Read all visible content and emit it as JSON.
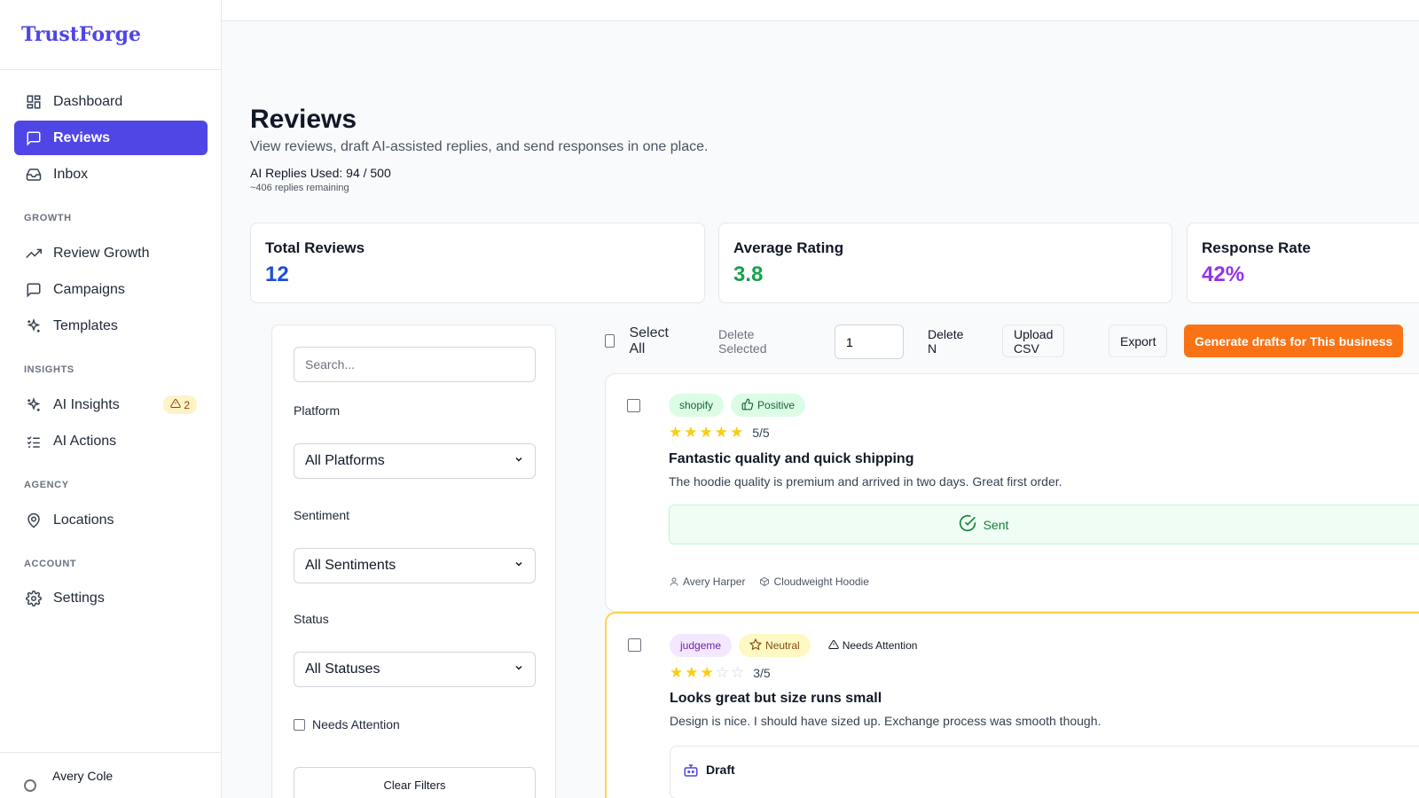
{
  "sidebar": {
    "brand": "TrustForge",
    "items": [
      {
        "label": "Dashboard",
        "icon": "dashboard-icon"
      },
      {
        "label": "Reviews",
        "icon": "message-square-icon",
        "active": true
      },
      {
        "label": "Inbox",
        "icon": "inbox-icon"
      },
      {
        "label": "Review Growth",
        "icon": "trending-up-icon"
      },
      {
        "label": "Campaigns",
        "icon": "message-square-icon"
      },
      {
        "label": "Templates",
        "icon": "sparkles-icon"
      },
      {
        "label": "AI Insights",
        "icon": "sparkles-icon",
        "badge": "2"
      },
      {
        "label": "AI Actions",
        "icon": "list-checks-icon"
      },
      {
        "label": "Locations",
        "icon": "map-pin-icon"
      },
      {
        "label": "Settings",
        "icon": "gear-icon"
      }
    ],
    "sections": {
      "growth": "GROWTH",
      "insights": "INSIGHTS",
      "agency": "AGENCY",
      "account": "ACCOUNT"
    },
    "user": "Avery Cole"
  },
  "header": {
    "title": "Reviews",
    "subtitle": "View reviews, draft AI-assisted replies, and send responses in one place.",
    "usage": "AI Replies Used: 94 / 500",
    "remaining": "~406 replies remaining"
  },
  "stats": [
    {
      "label": "Total Reviews",
      "value": "12",
      "color": "#1d4ed8"
    },
    {
      "label": "Average Rating",
      "value": "3.8",
      "color": "#16a34a"
    },
    {
      "label": "Response Rate",
      "value": "42%",
      "color": "#9333ea"
    }
  ],
  "filters": {
    "search_placeholder": "Search...",
    "platform_label": "Platform",
    "platform_value": "All Platforms",
    "sentiment_label": "Sentiment",
    "sentiment_value": "All Sentiments",
    "status_label": "Status",
    "status_value": "All Statuses",
    "attention_label": "Needs Attention",
    "clear_label": "Clear Filters"
  },
  "toolbar": {
    "select_all": "Select All",
    "delete_selected": "Delete Selected",
    "count_value": "1",
    "delete_n": "Delete N",
    "upload": "Upload CSV",
    "export": "Export",
    "generate": "Generate drafts for This business"
  },
  "reviews": [
    {
      "platform": "shopify",
      "sentiment": "Positive",
      "rating": 5,
      "rating_text": "5/5",
      "title": "Fantastic quality and quick shipping",
      "body": "The hoodie quality is premium and arrived in two days. Great first order.",
      "status": "Sent",
      "author": "Avery Harper",
      "product": "Cloudweight Hoodie"
    },
    {
      "platform": "judgeme",
      "sentiment": "Neutral",
      "attention": "Needs Attention",
      "rating": 3,
      "rating_text": "3/5",
      "title": "Looks great but size runs small",
      "body": "Design is nice. I should have sized up. Exchange process was smooth though.",
      "status": "Draft"
    }
  ],
  "colors": {
    "accent": "#4f46e5",
    "orange": "#f97316",
    "star": "#facc15"
  }
}
